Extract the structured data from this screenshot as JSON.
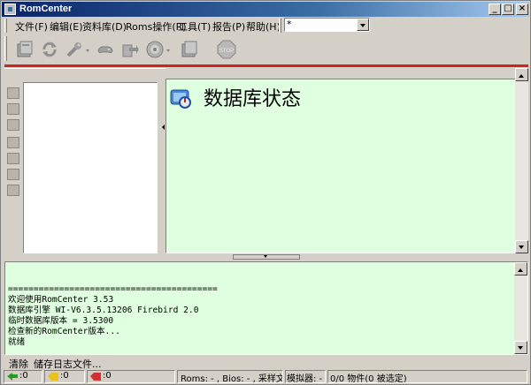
{
  "window": {
    "title": "RomCenter"
  },
  "menu": [
    {
      "label": "文件(F)"
    },
    {
      "label": "编辑(E)"
    },
    {
      "label": "资料库(D)"
    },
    {
      "label": "Roms操作(R)"
    },
    {
      "label": "工具(T)"
    },
    {
      "label": "报告(P)"
    },
    {
      "label": "帮助(H)"
    }
  ],
  "filter_combo": {
    "value": "*"
  },
  "toolbar": {
    "icons": [
      "open-database-icon",
      "refresh-icon",
      "tools-wrench-icon",
      "gamepad-icon",
      "export-icon",
      "scan-disc-icon",
      "add-files-icon",
      "stop-icon"
    ]
  },
  "main": {
    "title": "数据库状态"
  },
  "log": {
    "lines": [
      "=========================================",
      "欢迎使用RomCenter 3.53",
      "数据库引擎 WI-V6.3.5.13206 Firebird 2.0",
      "临时数据库版本 = 3.5300",
      "检查新的RomCenter版本...",
      "就绪"
    ]
  },
  "logbar": {
    "clear_label": "清除",
    "save_label": "储存日志文件..."
  },
  "status": {
    "green_count": ":0",
    "yellow_count": ":0",
    "red_count": ":0",
    "roms_info": "Roms: - , Bios: - , 采样文件: -",
    "emulator": "模拟器: -",
    "objects": "0/0 物件(0 被选定)"
  },
  "colors": {
    "content_bg": "#e0ffe0",
    "title_bar": "#0a246a",
    "accent_red": "#d32020"
  }
}
